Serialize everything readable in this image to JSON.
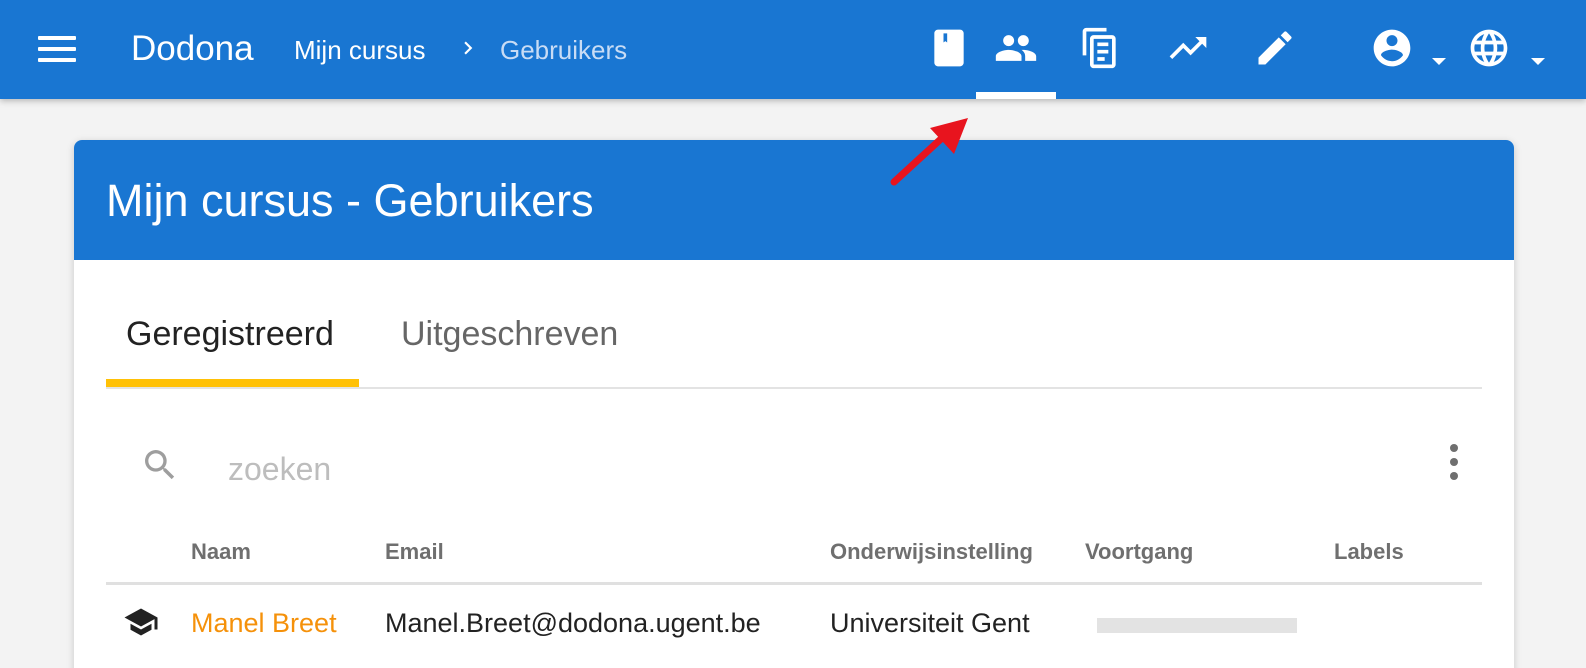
{
  "navbar": {
    "brand": "Dodona",
    "breadcrumb": [
      "Mijn cursus",
      "Gebruikers"
    ],
    "icons": [
      "book-icon",
      "users-icon",
      "submissions-icon",
      "statistics-icon",
      "edit-icon",
      "account-icon",
      "language-icon"
    ],
    "active_icon": "users-icon"
  },
  "card": {
    "title": "Mijn cursus - Gebruikers",
    "tabs": [
      {
        "label": "Geregistreerd",
        "active": true
      },
      {
        "label": "Uitgeschreven",
        "active": false
      }
    ],
    "search": {
      "placeholder": "zoeken",
      "value": ""
    },
    "table": {
      "headers": [
        "Naam",
        "Email",
        "Onderwijsinstelling",
        "Voortgang",
        "Labels"
      ],
      "rows": [
        {
          "role_icon": "student-icon",
          "name": "Manel Breet",
          "email": "Manel.Breet@dodona.ugent.be",
          "institution": "Universiteit Gent",
          "progress": 0,
          "labels": ""
        }
      ]
    }
  },
  "colors": {
    "primary": "#1976d2",
    "tab_indicator": "#ffc107",
    "link": "#f5910a",
    "annotation": "#e8141e"
  }
}
